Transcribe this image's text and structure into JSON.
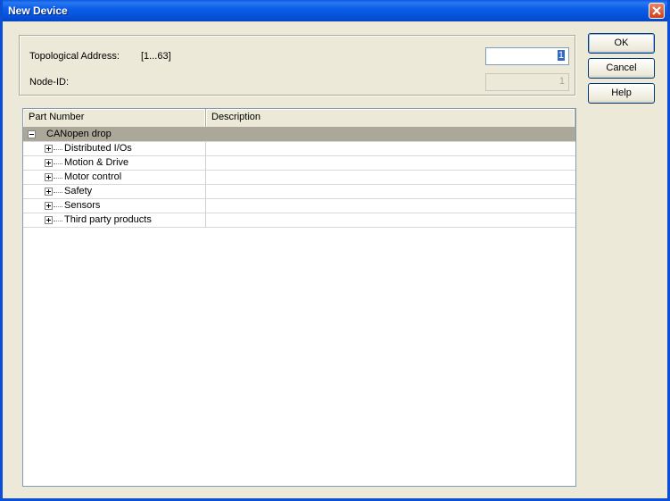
{
  "window": {
    "title": "New Device"
  },
  "form": {
    "topo_label": "Topological Address:",
    "topo_range": "[1...63]",
    "topo_value": "1",
    "node_label": "Node-ID:",
    "node_value": "1"
  },
  "buttons": {
    "ok": "OK",
    "cancel": "Cancel",
    "help": "Help"
  },
  "columns": [
    "Part Number",
    "Description"
  ],
  "tree": {
    "root": {
      "label": "CANopen drop",
      "description": ""
    },
    "children": [
      {
        "label": "Distributed I/Os",
        "description": ""
      },
      {
        "label": "Motion & Drive",
        "description": ""
      },
      {
        "label": "Motor control",
        "description": ""
      },
      {
        "label": "Safety",
        "description": ""
      },
      {
        "label": "Sensors",
        "description": ""
      },
      {
        "label": "Third party products",
        "description": ""
      }
    ]
  },
  "icons": {
    "close": "close-icon",
    "collapse": "minus-box-icon",
    "expand": "plus-box-icon"
  },
  "colors": {
    "title_bar": "#0650d8",
    "face": "#ece9d8",
    "selection": "#316ac5",
    "selected_row": "#aca899"
  }
}
